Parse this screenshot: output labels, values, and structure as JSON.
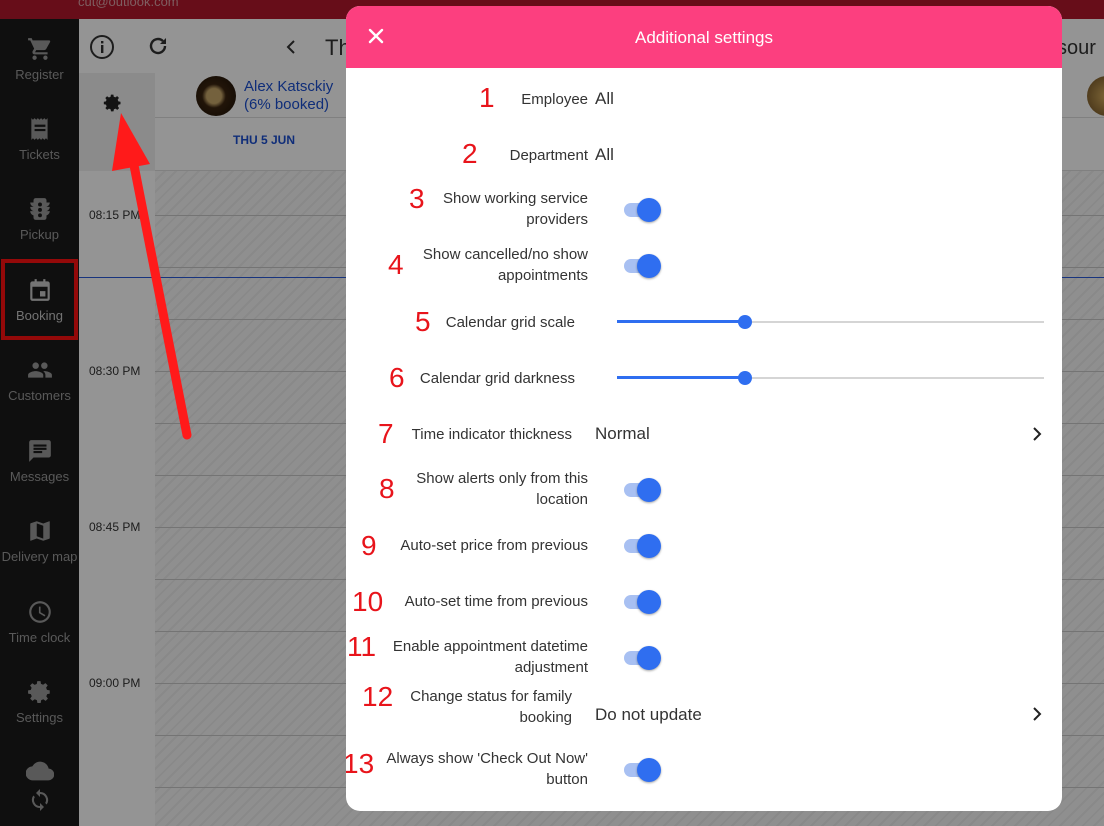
{
  "topbar": {
    "email": "cut@outlook.com"
  },
  "sidebar": {
    "items": [
      {
        "label": "Register",
        "icon": "cart-icon"
      },
      {
        "label": "Tickets",
        "icon": "receipt-icon"
      },
      {
        "label": "Pickup",
        "icon": "traffic-light-icon"
      },
      {
        "label": "Booking",
        "icon": "calendar-icon"
      },
      {
        "label": "Customers",
        "icon": "people-icon"
      },
      {
        "label": "Messages",
        "icon": "message-icon"
      },
      {
        "label": "Delivery map",
        "icon": "map-icon"
      },
      {
        "label": "Time clock",
        "icon": "clock-icon"
      },
      {
        "label": "Settings",
        "icon": "gear-icon"
      }
    ]
  },
  "calendar": {
    "toolbar_title": "Th",
    "toolbar_right": "sour",
    "employee_name": "Alex Katsckiy",
    "employee_booked": "(6% booked)",
    "day": "THU 5 JUN",
    "times": [
      "08:15 PM",
      "08:30 PM",
      "08:45 PM",
      "09:00 PM"
    ]
  },
  "dialog": {
    "title": "Additional settings",
    "rows": [
      {
        "num": "1",
        "label": "Employee",
        "value": "All"
      },
      {
        "num": "2",
        "label": "Department",
        "value": "All"
      },
      {
        "num": "3",
        "label": "Show working service providers",
        "toggle": true
      },
      {
        "num": "4",
        "label": "Show cancelled/no show appointments",
        "toggle": true
      },
      {
        "num": "5",
        "label": "Calendar grid scale",
        "slider": 0.3
      },
      {
        "num": "6",
        "label": "Calendar grid darkness",
        "slider": 0.3
      },
      {
        "num": "7",
        "label": "Time indicator thickness",
        "value": "Normal"
      },
      {
        "num": "8",
        "label": "Show alerts only from this location",
        "toggle": true
      },
      {
        "num": "9",
        "label": "Auto-set price from previous",
        "toggle": true
      },
      {
        "num": "10",
        "label": "Auto-set time from previous",
        "toggle": true
      },
      {
        "num": "11",
        "label": "Enable appointment datetime adjustment",
        "toggle": true
      },
      {
        "num": "12",
        "label": "Change status for family booking",
        "value": "Do not update"
      },
      {
        "num": "13",
        "label": "Always show 'Check Out Now' button",
        "toggle": true
      }
    ]
  },
  "colors": {
    "accent": "#fc3f7f",
    "toggle_on": "#2f6ef0",
    "annotation": "#e8141b",
    "sidebar": "#1a1a1a"
  }
}
